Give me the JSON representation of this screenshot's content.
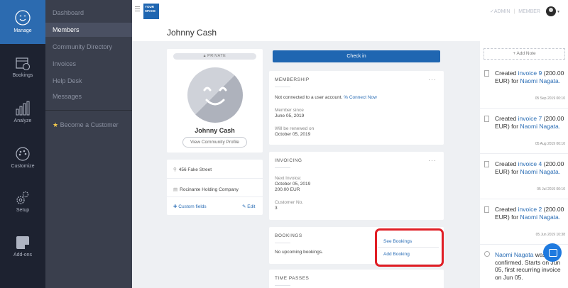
{
  "rail": [
    {
      "label": "Manage",
      "icon": "smiley-icon"
    },
    {
      "label": "Bookings",
      "icon": "calendar-icon"
    },
    {
      "label": "Analyze",
      "icon": "bar-chart-icon"
    },
    {
      "label": "Customize",
      "icon": "palette-icon"
    },
    {
      "label": "Setup",
      "icon": "gears-icon"
    },
    {
      "label": "Add-ons",
      "icon": "puzzle-icon"
    }
  ],
  "subnav": {
    "items": [
      "Dashboard",
      "Members",
      "Community Directory",
      "Invoices",
      "Help Desk",
      "Messages"
    ],
    "become": "Become a Customer"
  },
  "topbar": {
    "logo": [
      "YOUR",
      "SPACE"
    ],
    "admin": "ADMIN",
    "member": "MEMBER"
  },
  "page": {
    "title": "Johnny Cash"
  },
  "profile": {
    "privacy": "PRIVATE",
    "name": "Johnny Cash",
    "view_profile": "View Community Profile"
  },
  "details": {
    "address": "456 Fake Street",
    "company": "Rocinante Holding Company",
    "custom_fields": "Custom fields",
    "edit": "Edit"
  },
  "checkin": "Check in",
  "membership": {
    "title": "MEMBERSHIP",
    "not_connected": "Not connected to a user account.",
    "connect": "Connect Now",
    "since_label": "Member since",
    "since": "June 05, 2019",
    "renew_label": "Will be renewed on",
    "renew": "October 05, 2019"
  },
  "invoicing": {
    "title": "INVOICING",
    "next_label": "Next Invoice:",
    "next_date": "October 05, 2019",
    "next_amount": "200.00 EUR",
    "customer_label": "Customer No.",
    "customer_no": "3"
  },
  "bookings": {
    "title": "BOOKINGS",
    "empty": "No upcoming bookings.",
    "see": "See Bookings",
    "add": "Add Booking"
  },
  "time_passes": {
    "title": "TIME PASSES"
  },
  "timeline": {
    "add_note": "+ Add Note",
    "entries": [
      {
        "pre": "Created",
        "link": "invoice 9",
        "mid": "(200.00 EUR) for",
        "who": "Naomi Nagata.",
        "date": "05 Sep 2019 00:10"
      },
      {
        "pre": "Created",
        "link": "invoice 7",
        "mid": "(200.00 EUR) for",
        "who": "Naomi Nagata.",
        "date": "05 Aug 2019 00:10"
      },
      {
        "pre": "Created",
        "link": "invoice 4",
        "mid": "(200.00 EUR) for",
        "who": "Naomi Nagata.",
        "date": "05 Jul 2019 00:10"
      },
      {
        "pre": "Created",
        "link": "invoice 2",
        "mid": "(200.00 EUR) for",
        "who": "Naomi Nagata.",
        "date": "05 Jun 2019 10:38"
      }
    ],
    "confirmed": {
      "who": "Naomi Nagata",
      "text": "was confirmed. Starts on Jun 05, first recurring invoice on Jun 05."
    }
  },
  "colors": {
    "accent": "#1f66b1",
    "rail_bg": "#1d2230",
    "subnav_bg": "#3a3f4d",
    "highlight": "#e01e25"
  }
}
